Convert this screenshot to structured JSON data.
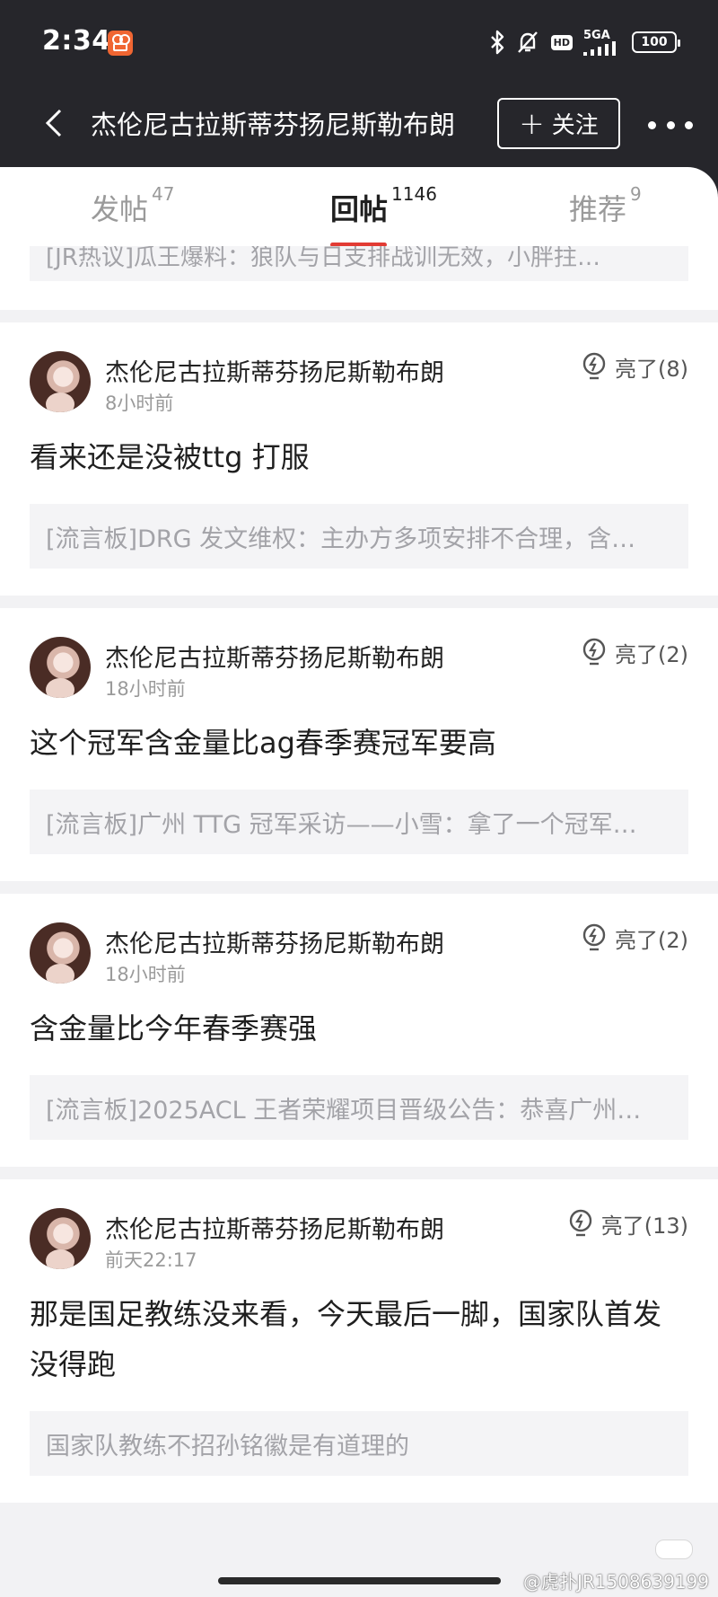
{
  "status_bar": {
    "time": "2:34",
    "hd": "HD",
    "network": "5GA",
    "battery": "100"
  },
  "nav": {
    "title": "杰伦尼古拉斯蒂芬扬尼斯勒布朗",
    "follow_plus": "+",
    "follow_label": "关注"
  },
  "tabs": [
    {
      "label": "发帖",
      "count": "47"
    },
    {
      "label": "回帖",
      "count": "1146"
    },
    {
      "label": "推荐",
      "count": "9"
    }
  ],
  "prev_quote": "[JR热议]瓜王爆料：狼队与日支排战训无效，小胖拄…",
  "replies": [
    {
      "author": "杰伦尼古拉斯蒂芬扬尼斯勒布朗",
      "time": "8小时前",
      "likes": "亮了(8)",
      "text": "看来还是没被ttg 打服",
      "quote": "[流言板]DRG 发文维权：主办方多项安排不合理，含…"
    },
    {
      "author": "杰伦尼古拉斯蒂芬扬尼斯勒布朗",
      "time": "18小时前",
      "likes": "亮了(2)",
      "text": "这个冠军含金量比ag春季赛冠军要高",
      "quote": "[流言板]广州 TTG 冠军采访——小雪：拿了一个冠军…"
    },
    {
      "author": "杰伦尼古拉斯蒂芬扬尼斯勒布朗",
      "time": "18小时前",
      "likes": "亮了(2)",
      "text": "含金量比今年春季赛强",
      "quote": "[流言板]2025ACL 王者荣耀项目晋级公告：恭喜广州…"
    },
    {
      "author": "杰伦尼古拉斯蒂芬扬尼斯勒布朗",
      "time": "前天22:17",
      "likes": "亮了(13)",
      "text": "那是国足教练没来看，今天最后一脚，国家队首发没得跑",
      "quote": "国家队教练不招孙铭徽是有道理的"
    }
  ],
  "watermark": "@虎扑JR1508639199"
}
